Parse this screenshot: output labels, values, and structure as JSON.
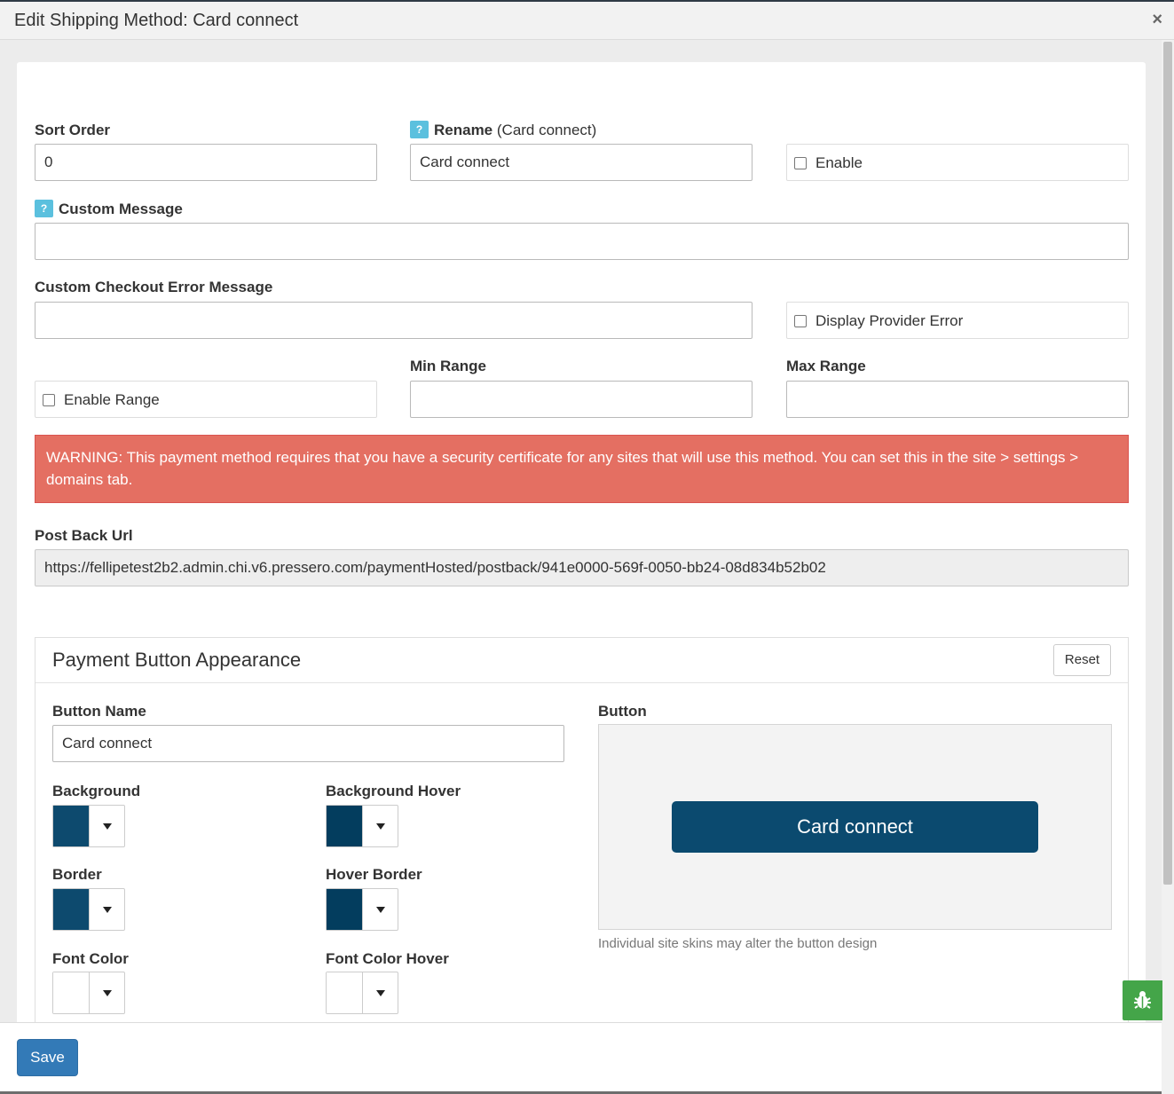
{
  "dialog": {
    "title": "Edit Shipping Method: Card connect",
    "close": "×"
  },
  "form": {
    "sort_order": {
      "label": "Sort Order",
      "value": "0"
    },
    "rename": {
      "help": "?",
      "label": "Rename",
      "hint": "(Card connect)",
      "value": "Card connect"
    },
    "enable": {
      "label": "Enable",
      "checked": false
    },
    "custom_message": {
      "help": "?",
      "label": "Custom Message",
      "value": ""
    },
    "checkout_error": {
      "label": "Custom Checkout Error Message",
      "value": ""
    },
    "display_provider_error": {
      "label": "Display Provider Error",
      "checked": false
    },
    "enable_range": {
      "label": "Enable Range",
      "checked": false
    },
    "min_range": {
      "label": "Min Range",
      "value": ""
    },
    "max_range": {
      "label": "Max Range",
      "value": ""
    },
    "warning": "WARNING: This payment method requires that you have a security certificate for any sites that will use this method. You can set this in the site > settings > domains tab.",
    "post_back": {
      "label": "Post Back Url",
      "value": "https://fellipetest2b2.admin.chi.v6.pressero.com/paymentHosted/postback/941e0000-569f-0050-bb24-08d834b52b02"
    }
  },
  "appearance": {
    "title": "Payment Button Appearance",
    "reset_label": "Reset",
    "button_name": {
      "label": "Button Name",
      "value": "Card connect"
    },
    "background": {
      "label": "Background",
      "color": "#0d4a6e"
    },
    "background_hover": {
      "label": "Background Hover",
      "color": "#033d5e"
    },
    "border": {
      "label": "Border",
      "color": "#0d4a6e"
    },
    "hover_border": {
      "label": "Hover Border",
      "color": "#033d5e"
    },
    "font_color": {
      "label": "Font Color",
      "color": "#ffffff"
    },
    "font_color_hover": {
      "label": "Font Color Hover",
      "color": "#ffffff"
    },
    "preview": {
      "label": "Button",
      "button_text": "Card connect",
      "button_color": "#0b4a6f"
    },
    "hint": "Individual site skins may alter the button design"
  },
  "footer": {
    "save_label": "Save"
  },
  "icons": {
    "bug": "bug-icon"
  }
}
